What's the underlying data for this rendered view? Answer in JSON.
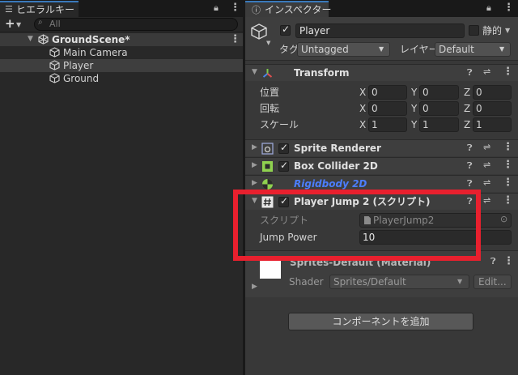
{
  "hierarchy": {
    "tab_label": "ヒエラルキー",
    "add_label": "+",
    "search_placeholder": "All",
    "scene_name": "GroundScene*",
    "objects": [
      "Main Camera",
      "Player",
      "Ground"
    ]
  },
  "inspector": {
    "tab_label": "インスペクター",
    "object_name": "Player",
    "static_label": "静的",
    "tag_label": "タグ",
    "tag_value": "Untagged",
    "layer_label": "レイヤー",
    "layer_value": "Default",
    "transform": {
      "title": "Transform",
      "position_label": "位置",
      "rotation_label": "回転",
      "scale_label": "スケール",
      "axis_x": "X",
      "axis_y": "Y",
      "axis_z": "Z",
      "position": [
        "0",
        "0",
        "0"
      ],
      "rotation": [
        "0",
        "0",
        "0"
      ],
      "scale": [
        "1",
        "1",
        "1"
      ]
    },
    "components": {
      "sprite_renderer": "Sprite Renderer",
      "box_collider": "Box Collider 2D",
      "rigidbody": "Rigidbody 2D",
      "player_jump": "Player Jump 2 (スクリプト)"
    },
    "script": {
      "script_label": "スクリプト",
      "script_value": "PlayerJump2",
      "jump_power_label": "Jump Power",
      "jump_power_value": "10"
    },
    "material": {
      "name": "Sprites-Default (Material)",
      "shader_label": "Shader",
      "shader_value": "Sprites/Default",
      "edit_label": "Edit..."
    },
    "add_component_label": "コンポーネントを追加"
  },
  "colors": {
    "highlight_box": "#e8202e",
    "rigidbody_label": "#4c7eff",
    "tab_accent": "#3a79bb"
  }
}
